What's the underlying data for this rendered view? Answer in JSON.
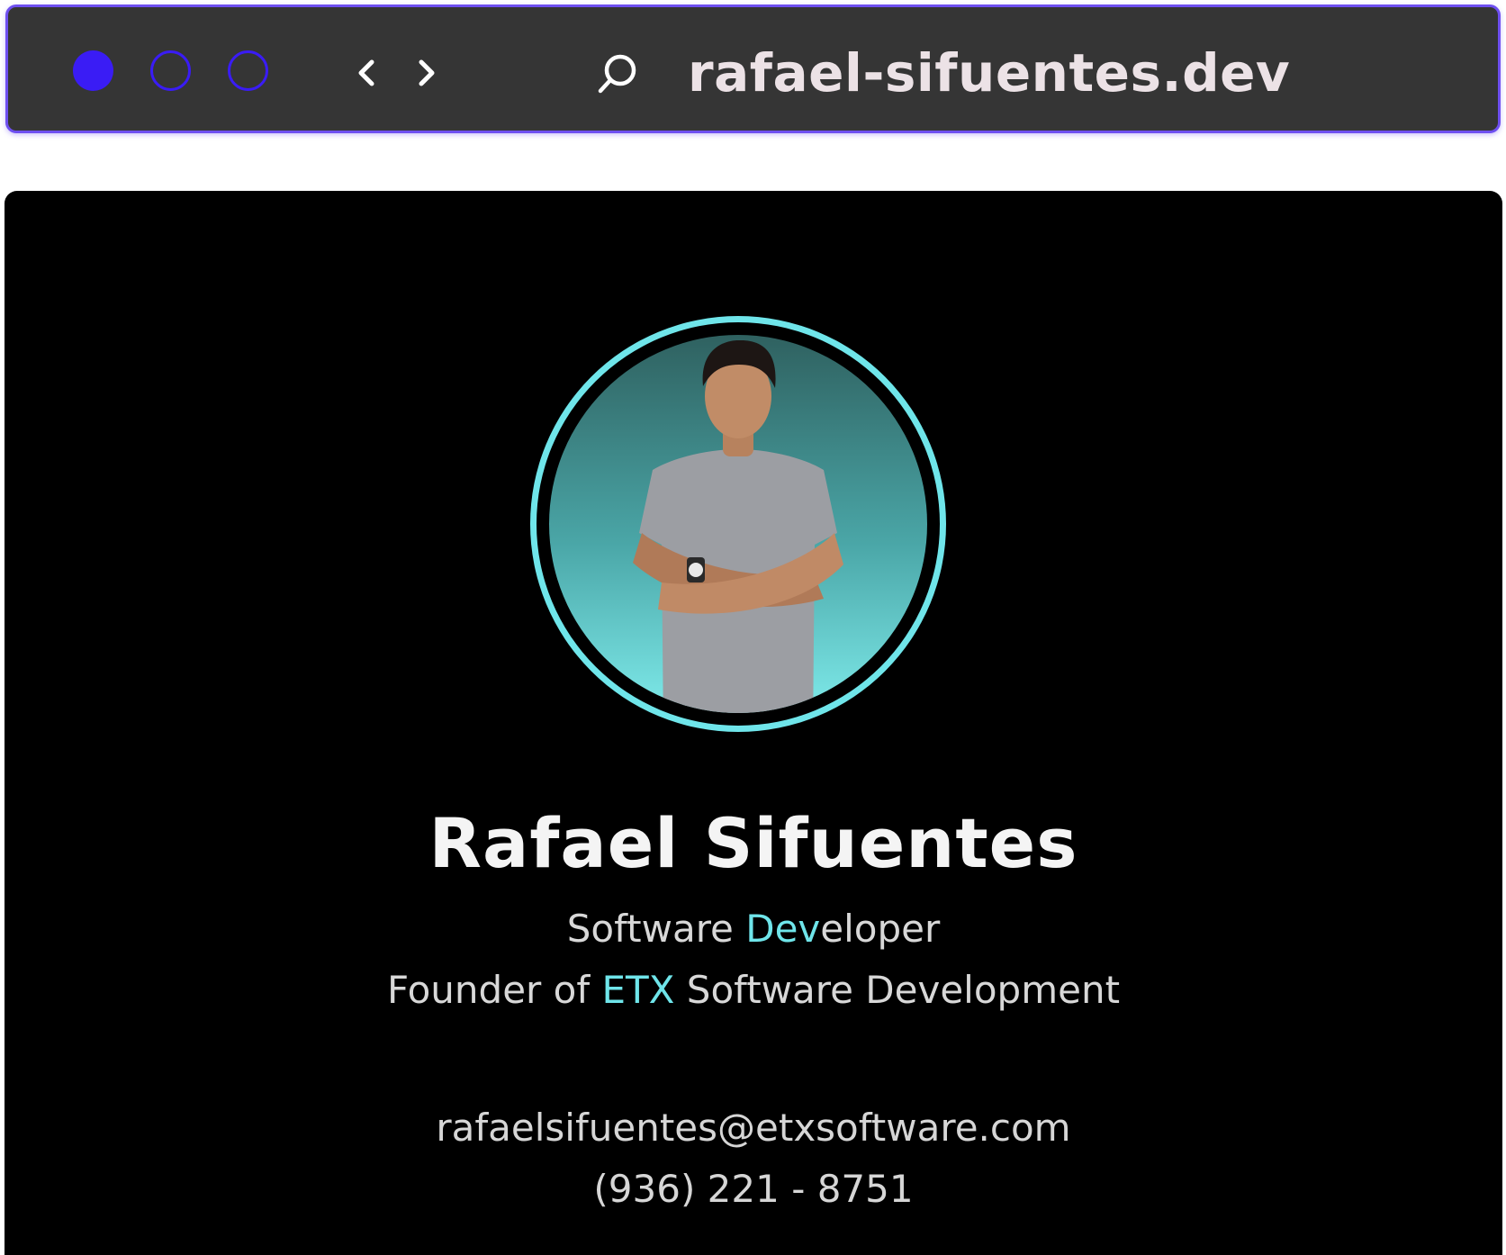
{
  "colors": {
    "toolbar_background": "#353535",
    "toolbar_border": "#6e4ff0",
    "window_dot": "#3a1cf5",
    "url_text": "#ece2e6",
    "page_background": "#000000",
    "accent_cyan": "#6fe5ea",
    "name_text": "#f4f4f4",
    "body_text": "#d8d8d8"
  },
  "toolbar": {
    "window_controls": [
      {
        "icon": "filled-circle-icon"
      },
      {
        "icon": "outline-circle-icon"
      },
      {
        "icon": "outline-circle-icon"
      }
    ],
    "back_icon": "chevron-left-icon",
    "forward_icon": "chevron-right-icon",
    "search_icon": "search-icon",
    "url": "rafael-sifuentes.dev"
  },
  "profile": {
    "photo": "profile-photo",
    "name": "Rafael Sifuentes",
    "title": {
      "before": "Software ",
      "highlight": "Dev",
      "after": "eloper"
    },
    "company": {
      "before": "Founder of ",
      "highlight": "ETX",
      "after": " Software Development"
    },
    "email": "rafaelsifuentes@etxsoftware.com",
    "phone": "(936) 221 - 8751"
  }
}
